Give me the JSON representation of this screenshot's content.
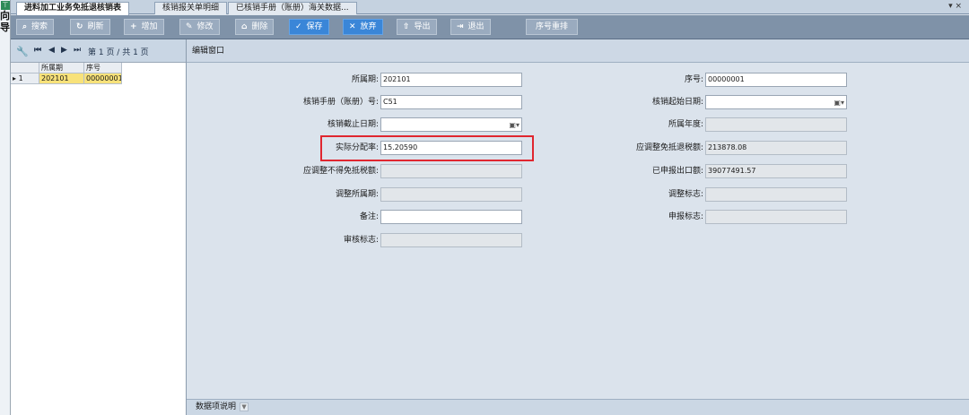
{
  "guide": {
    "text": [
      "向",
      "导"
    ]
  },
  "tabs": [
    {
      "label": "进料加工业务免抵退核销表",
      "active": true
    },
    {
      "label": "核销报关单明细",
      "active": false
    },
    {
      "label": "已核销手册（账册）海关数据...",
      "active": false
    }
  ],
  "window_close": "▾ ×",
  "toolbar": {
    "search": "搜索",
    "refresh": "刷新",
    "add": "增加",
    "edit": "修改",
    "delete": "删除",
    "save": "保存",
    "discard": "放弃",
    "export": "导出",
    "exit": "退出",
    "reorder": "序号重排"
  },
  "pager": {
    "text": "第 1 页 / 共 1 页"
  },
  "grid": {
    "headers": [
      "所属期",
      "序号"
    ],
    "rows": [
      {
        "rownum": "1",
        "period": "202101",
        "seq": "00000001"
      }
    ]
  },
  "edit": {
    "title": "编辑窗口",
    "left": {
      "period_label": "所属期:",
      "period_value": "202101",
      "manual_label": "核销手册（账册）号:",
      "manual_value": "C51",
      "end_date_label": "核销截止日期:",
      "end_date_value": "",
      "ratio_label": "实际分配率:",
      "ratio_value": "15.20590",
      "nonexempt_label": "应调整不得免抵税额:",
      "nonexempt_value": "",
      "adj_period_label": "调整所属期:",
      "adj_period_value": "",
      "note_label": "备注:",
      "note_value": "",
      "audit_label": "审核标志:",
      "audit_value": ""
    },
    "right": {
      "seq_label": "序号:",
      "seq_value": "00000001",
      "start_date_label": "核销起始日期:",
      "start_date_value": "",
      "year_label": "所属年度:",
      "year_value": "",
      "adj_exempt_label": "应调整免抵退税额:",
      "adj_exempt_value": "213878.08",
      "declared_label": "已申报出口额:",
      "declared_value": "39077491.57",
      "adj_flag_label": "调整标志:",
      "adj_flag_value": "",
      "declare_flag_label": "申报标志:",
      "declare_flag_value": ""
    },
    "footer": "数据项说明"
  }
}
